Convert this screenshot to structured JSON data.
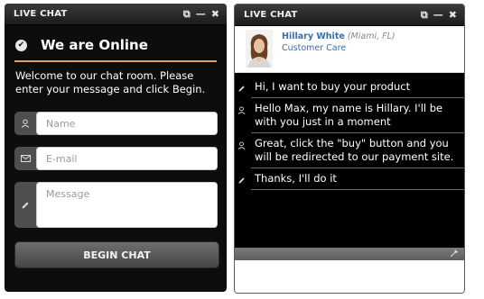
{
  "left_widget": {
    "title": "LIVE CHAT",
    "controls": {
      "popout": "⧉",
      "minimize": "—",
      "close": "✖"
    },
    "heading": "We are Online",
    "welcome": "Welcome to our chat room. Please enter your message and click Begin.",
    "fields": {
      "name_placeholder": "Name",
      "email_placeholder": "E-mail",
      "message_placeholder": "Message"
    },
    "begin_button": "BEGIN CHAT"
  },
  "right_widget": {
    "title": "LIVE CHAT",
    "controls": {
      "popout": "⧉",
      "minimize": "—",
      "close": "✖"
    },
    "agent": {
      "name": "Hillary White",
      "location": "(Miami, FL)",
      "role": "Customer Care"
    },
    "messages": [
      {
        "sender": "visitor",
        "icon": "pencil-icon",
        "text": "Hi, I want to buy your product"
      },
      {
        "sender": "agent",
        "icon": "user-icon",
        "text": "Hello Max, my name is Hillary. I'll be with you just in a moment"
      },
      {
        "sender": "agent",
        "icon": "user-icon",
        "text": "Great, click the \"buy\" button and you will be redirected to our payment site."
      },
      {
        "sender": "visitor",
        "icon": "pencil-icon",
        "text": "Thanks, I'll do it"
      }
    ]
  },
  "colors": {
    "accent_orange": "#e8a060",
    "link_blue": "#3a6ea5"
  }
}
